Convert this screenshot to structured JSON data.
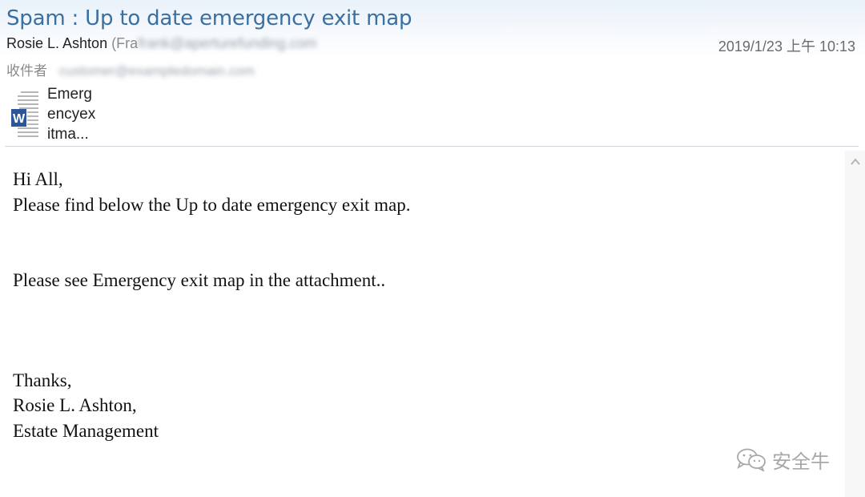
{
  "message": {
    "subject": "Spam : Up to date emergency exit map",
    "sender_name": "Rosie L. Ashton",
    "sender_email_prefix": "(Fra",
    "sender_email_redacted": "frank@aperturefunding.com",
    "date": "2019/1/23 上午 10:13",
    "to_label": "收件者",
    "to_value_redacted": "customer@exampledomain.com"
  },
  "attachment": {
    "name": "Emerg\nencyex\nitma...",
    "icon": "word-document-icon"
  },
  "body": {
    "greeting": "Hi All,",
    "line1": "Please find below the Up to date emergency exit map.",
    "line2": "Please see Emergency exit map in the attachment..",
    "closing": "Thanks,",
    "signature_name": "Rosie L. Ashton,",
    "signature_dept": "Estate Management"
  },
  "watermark": {
    "text": "安全牛",
    "icon": "wechat-icon"
  },
  "colors": {
    "subject": "#3a6fa1",
    "word_blue": "#2b579a",
    "header_gradient_top": "#e9f1fa"
  }
}
